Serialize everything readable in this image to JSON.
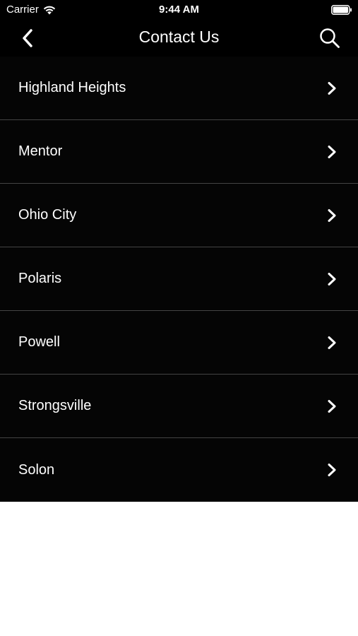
{
  "status_bar": {
    "carrier": "Carrier",
    "time": "9:44 AM",
    "wifi_icon": "wifi-icon",
    "battery_icon": "battery-icon"
  },
  "nav_bar": {
    "title": "Contact Us",
    "back_icon": "chevron-left-icon",
    "search_icon": "search-icon"
  },
  "locations": [
    {
      "label": "Highland Heights"
    },
    {
      "label": "Mentor"
    },
    {
      "label": "Ohio City"
    },
    {
      "label": "Polaris"
    },
    {
      "label": "Powell"
    },
    {
      "label": "Strongsville"
    },
    {
      "label": "Solon"
    }
  ],
  "colors": {
    "bar_background": "#000000",
    "list_background": "#050505",
    "divider": "#444444",
    "text": "#ffffff",
    "page_background": "#ffffff"
  }
}
